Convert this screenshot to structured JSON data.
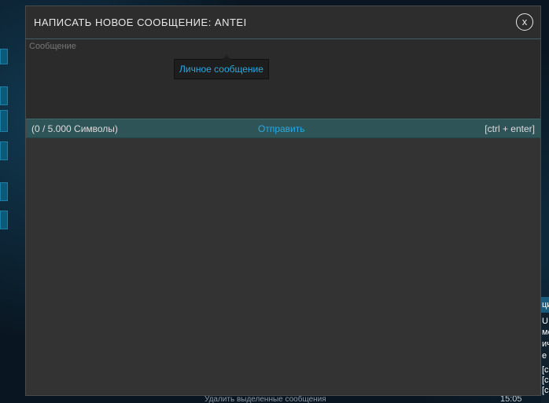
{
  "dialog": {
    "title": "НАПИСАТЬ НОВОЕ СООБЩЕНИЕ: ANTEI",
    "close_label": "x",
    "message_placeholder": "Сообщение",
    "message_value": "",
    "tooltip_text": "Личное сообщение",
    "char_count": "(0 / 5.000 Символы)",
    "send_label": "Отправить",
    "shortcut_hint": "[ctrl + enter]"
  },
  "background": {
    "right_panel_lines": [
      "ци",
      "U",
      "ме",
      "ич",
      "е",
      "[c",
      "[c",
      "[c"
    ],
    "bottom_text": "Удалить выделенные сообщения",
    "clock": "15:05"
  },
  "colors": {
    "dialog_bg": "#333333",
    "footer_bg": "#2e5458",
    "accent": "#29a9e1"
  }
}
